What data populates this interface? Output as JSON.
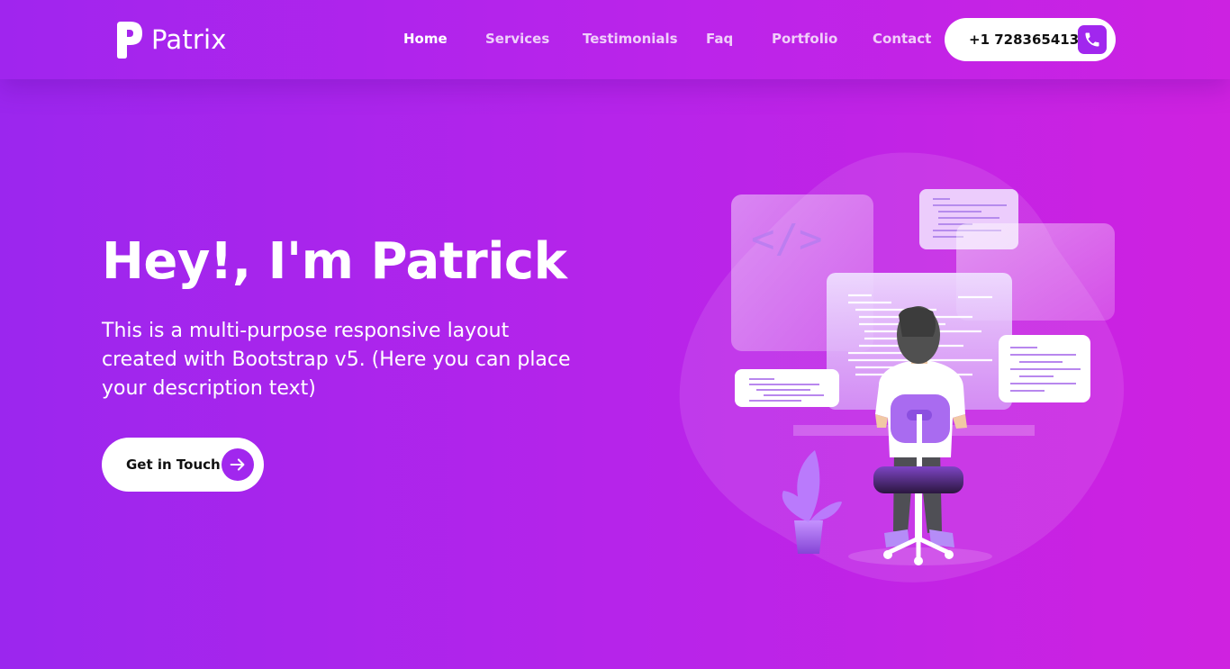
{
  "brand": {
    "name": "Patrix",
    "logo_icon": "p-letter-logo"
  },
  "nav": {
    "items": [
      {
        "label": "Home",
        "active": true
      },
      {
        "label": "Services",
        "active": false
      },
      {
        "label": "Testimonials",
        "active": false
      },
      {
        "label": "Faq",
        "active": false
      },
      {
        "label": "Portfolio",
        "active": false
      },
      {
        "label": "Contact",
        "active": false
      }
    ],
    "phone": {
      "number": "+1 728365413",
      "icon": "phone-icon"
    }
  },
  "hero": {
    "title": "Hey!, I'm Patrick",
    "description": "This is a multi-purpose responsive layout created with Bootstrap v5. (Here you can place your description text)",
    "cta_label": "Get in Touch",
    "cta_icon": "arrow-right-icon",
    "code_glyph": "</>"
  },
  "colors": {
    "accent": "#a127ee",
    "gradient_start": "#9b26ee",
    "gradient_end": "#cf22e0",
    "button_bg": "#ffffff",
    "button_text": "#111111"
  }
}
